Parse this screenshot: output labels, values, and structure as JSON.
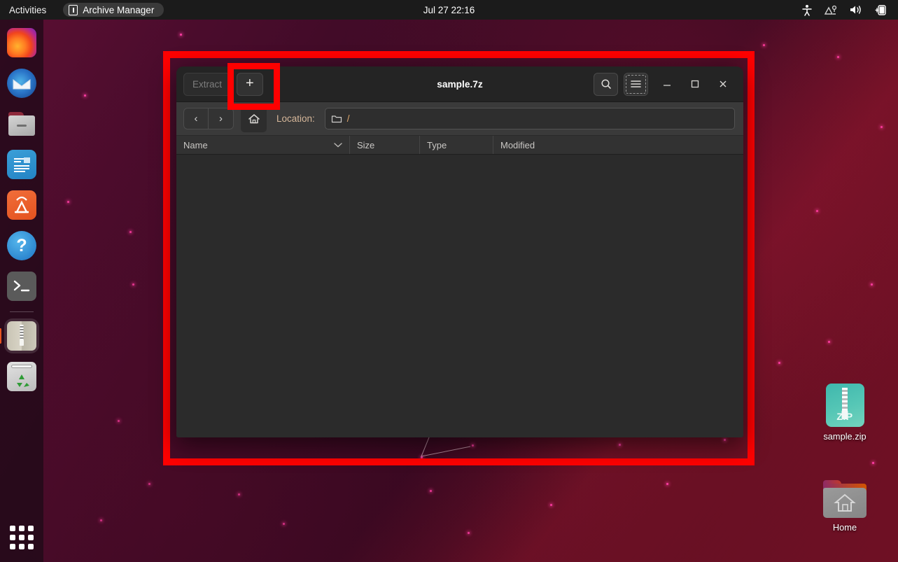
{
  "topbar": {
    "activities": "Activities",
    "app_name": "Archive Manager",
    "clock": "Jul 27  22:16",
    "tray": [
      "accessibility-icon",
      "network-icon",
      "volume-icon",
      "battery-icon"
    ]
  },
  "dock": {
    "items": [
      {
        "name": "firefox",
        "label": "Firefox"
      },
      {
        "name": "thunderbird",
        "label": "Thunderbird"
      },
      {
        "name": "files",
        "label": "Files"
      },
      {
        "name": "libreoffice-writer",
        "label": "LibreOffice Writer"
      },
      {
        "name": "ubuntu-software",
        "label": "Ubuntu Software"
      },
      {
        "name": "help",
        "label": "Help"
      },
      {
        "name": "terminal",
        "label": "Terminal"
      },
      {
        "name": "archive-manager",
        "label": "Archive Manager",
        "active": true
      },
      {
        "name": "trash",
        "label": "Trash"
      }
    ],
    "show_apps": "Show Applications"
  },
  "window": {
    "title": "sample.7z",
    "toolbar": {
      "extract_label": "Extract",
      "extract_disabled": true,
      "add_label": "+",
      "search_icon": "search-icon",
      "menu_icon": "hamburger-menu-icon",
      "minimize_label": "–",
      "maximize_label": "□",
      "close_label": "✕"
    },
    "location": {
      "back_label": "‹",
      "forward_label": "›",
      "home_icon": "home-icon",
      "label": "Location:",
      "folder_icon": "folder-icon",
      "path": "/"
    },
    "columns": [
      {
        "key": "name",
        "label": "Name",
        "sort_icon": "chevron-down-icon"
      },
      {
        "key": "size",
        "label": "Size"
      },
      {
        "key": "type",
        "label": "Type"
      },
      {
        "key": "modified",
        "label": "Modified"
      }
    ],
    "rows": []
  },
  "desktop": {
    "icons": [
      {
        "name": "sample-zip",
        "label": "sample.zip",
        "glyph_text": "ZiP"
      },
      {
        "name": "home-folder",
        "label": "Home"
      }
    ]
  },
  "annotations": {
    "highlight_color": "#ff0000",
    "targets": [
      "archive-manager-window",
      "add-files-button"
    ]
  }
}
